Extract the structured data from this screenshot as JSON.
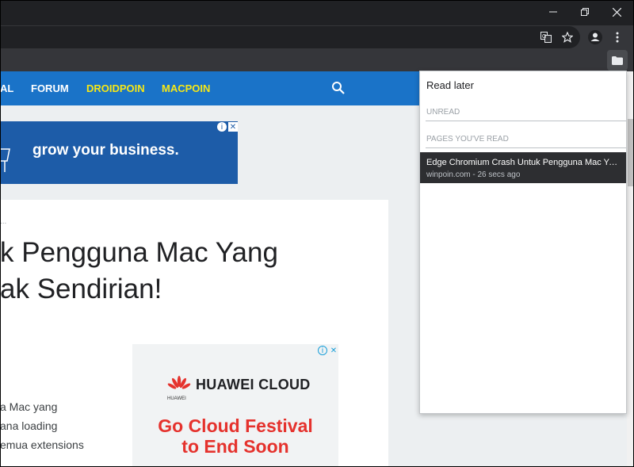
{
  "window": {
    "minimize_icon": "minimize-icon",
    "restore_icon": "restore-icon",
    "close_icon": "close-icon"
  },
  "toolbar": {
    "icons": [
      "translate-icon",
      "star-icon",
      "profile-icon",
      "more-vert-icon"
    ]
  },
  "extensions": {
    "reading_list_icon": "folder-icon"
  },
  "site": {
    "nav": [
      "AL",
      "FORUM",
      "DROIDPOIN",
      "MACPOIN"
    ],
    "nav_colors": {
      "primary": "#1a73c8",
      "highlight": "#f6e716"
    },
    "ad_top_text": "grow your business.",
    "meta": "...",
    "headline_line1": "k Pengguna Mac Yang",
    "headline_line2": "ak Sendirian!",
    "body_lines": [
      "a Mac yang",
      "ana loading",
      "emua extensions"
    ],
    "ad_brand": "HUAWEI CLOUD",
    "ad_brand_sub": "HUAWEI",
    "ad_line1": "Go Cloud Festival",
    "ad_line2": "to End Soon"
  },
  "read_later": {
    "title": "Read later",
    "unread_label": "UNREAD",
    "read_label": "PAGES YOU'VE READ",
    "items": [
      {
        "title": "Edge Chromium Crash Untuk Pengguna Mac Yang Tidak Sendirian!",
        "subtitle": "winpoin.com - 26 secs ago"
      }
    ]
  }
}
